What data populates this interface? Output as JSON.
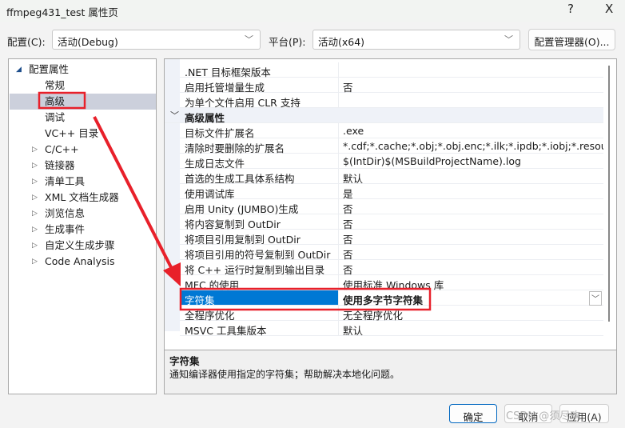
{
  "window": {
    "title": "ffmpeg431_test 属性页",
    "help": "?",
    "close": "X"
  },
  "config": {
    "label": "配置(C):",
    "value": "活动(Debug)"
  },
  "platform": {
    "label": "平台(P):",
    "value": "活动(x64)"
  },
  "config_manager": "配置管理器(O)...",
  "tree": {
    "root": "配置属性",
    "items": [
      {
        "label": "常规",
        "expandable": false
      },
      {
        "label": "高级",
        "expandable": false,
        "selected": true
      },
      {
        "label": "调试",
        "expandable": false
      },
      {
        "label": "VC++ 目录",
        "expandable": false
      },
      {
        "label": "C/C++",
        "expandable": true
      },
      {
        "label": "链接器",
        "expandable": true
      },
      {
        "label": "清单工具",
        "expandable": true
      },
      {
        "label": "XML 文档生成器",
        "expandable": true
      },
      {
        "label": "浏览信息",
        "expandable": true
      },
      {
        "label": "生成事件",
        "expandable": true
      },
      {
        "label": "自定义生成步骤",
        "expandable": true
      },
      {
        "label": "Code Analysis",
        "expandable": true
      }
    ]
  },
  "grid": {
    "top_rows": [
      {
        "name": ".NET 目标框架版本",
        "value": ""
      },
      {
        "name": "启用托管增量生成",
        "value": "否"
      },
      {
        "name": "为单个文件启用 CLR 支持",
        "value": ""
      }
    ],
    "category": "高级属性",
    "rows": [
      {
        "name": "目标文件扩展名",
        "value": ".exe"
      },
      {
        "name": "清除时要删除的扩展名",
        "value": "*.cdf;*.cache;*.obj;*.obj.enc;*.ilk;*.ipdb;*.iobj;*.resources;*.tlb;*.tli;*.tlh;*.tmp"
      },
      {
        "name": "生成日志文件",
        "value": "$(IntDir)$(MSBuildProjectName).log"
      },
      {
        "name": "首选的生成工具体系结构",
        "value": "默认"
      },
      {
        "name": "使用调试库",
        "value": "是"
      },
      {
        "name": "启用 Unity (JUMBO)生成",
        "value": "否"
      },
      {
        "name": "将内容复制到 OutDir",
        "value": "否"
      },
      {
        "name": "将项目引用复制到 OutDir",
        "value": "否"
      },
      {
        "name": "将项目引用的符号复制到 OutDir",
        "value": "否"
      },
      {
        "name": "将 C++ 运行时复制到输出目录",
        "value": "否"
      },
      {
        "name": "MFC 的使用",
        "value": "使用标准 Windows 库"
      },
      {
        "name": "字符集",
        "value": "使用多字节字符集",
        "selected": true
      },
      {
        "name": "全程序优化",
        "value": "无全程序优化"
      },
      {
        "name": "MSVC 工具集版本",
        "value": "默认"
      }
    ]
  },
  "description": {
    "title": "字符集",
    "text": "通知编译器使用指定的字符集；帮助解决本地化问题。"
  },
  "buttons": {
    "ok": "确定",
    "cancel": "取消",
    "apply": "应用(A)"
  },
  "watermark": "CSDN @须尽欢",
  "colors": {
    "selection": "#0078d4",
    "annotation": "#e8202a"
  }
}
